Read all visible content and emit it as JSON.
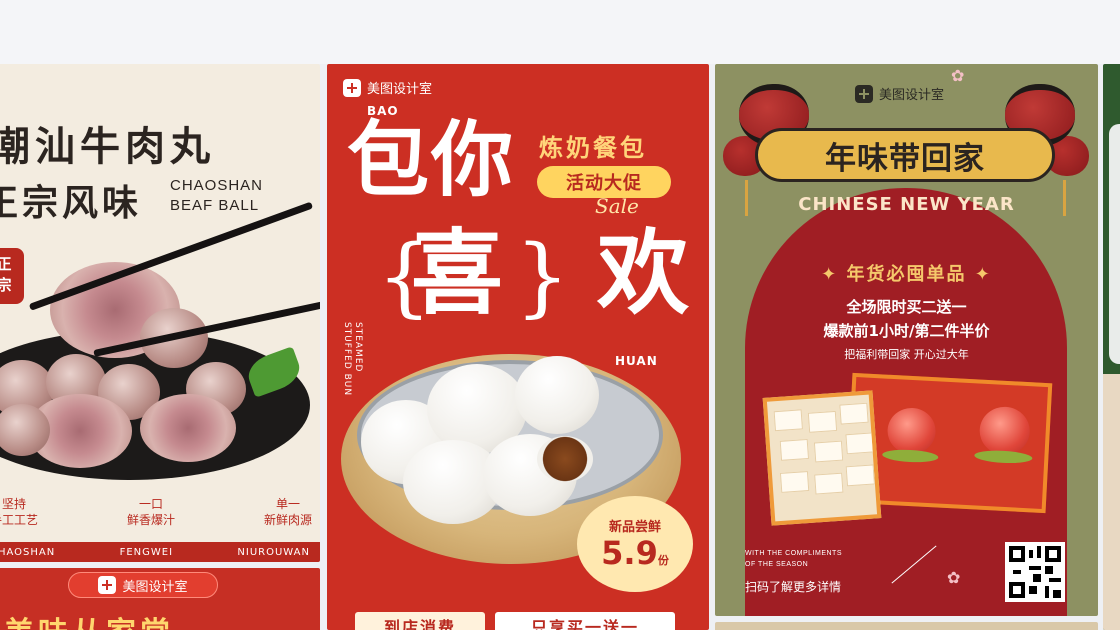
{
  "colors": {
    "page_bg": "#eef0f4",
    "card_red": "#cc2f23",
    "olive": "#8d9162",
    "gold": "#ffd45f"
  },
  "card1": {
    "title_line1": "潮汕牛肉丸",
    "title_line2": "正宗风味",
    "english": [
      "CHAOSHAN",
      "BEAF BALL"
    ],
    "seal": [
      "正",
      "宗"
    ],
    "tags": [
      {
        "top": "坚持",
        "bottom": "手工工艺"
      },
      {
        "top": "一口",
        "bottom": "鲜香爆汁"
      },
      {
        "top": "单一",
        "bottom": "新鲜肉源"
      }
    ],
    "footer": [
      "CHAOSHAN",
      "FENGWEI",
      "NIUROUWAN"
    ]
  },
  "card1b": {
    "brand": "美图设计室",
    "headline": "美味从家常"
  },
  "card2": {
    "brand": "美图设计室",
    "bao": "BAO",
    "headline_top": "包你",
    "headline_mid": "喜",
    "headline_right": "欢",
    "brace_left": "{",
    "brace_right": "}",
    "subtitle": "炼奶餐包",
    "promo": "活动大促",
    "sale": "Sale",
    "vertical_en": [
      "STEAMED",
      "STUFFED BUN"
    ],
    "huan": "HUAN",
    "badge_top": "新品尝鲜",
    "badge_price": "5.9",
    "badge_unit": "份",
    "bottom_left": "到店消费",
    "bottom_right": "只享买一送一"
  },
  "card3": {
    "brand": "美图设计室",
    "banner": "年味带回家",
    "arc_text": "CHINESE NEW YEAR",
    "section_title": "✦ 年货必囤单品 ✦",
    "line1": "全场限时买二送一",
    "line2": "爆款前1小时/第二件半价",
    "line3": "把福利带回家 开心过大年",
    "compliments": [
      "WITH THE COMPLIMENTS",
      "OF THE SEASON"
    ],
    "scan": "扫码了解更多详情",
    "flower_glyph": "✿"
  }
}
